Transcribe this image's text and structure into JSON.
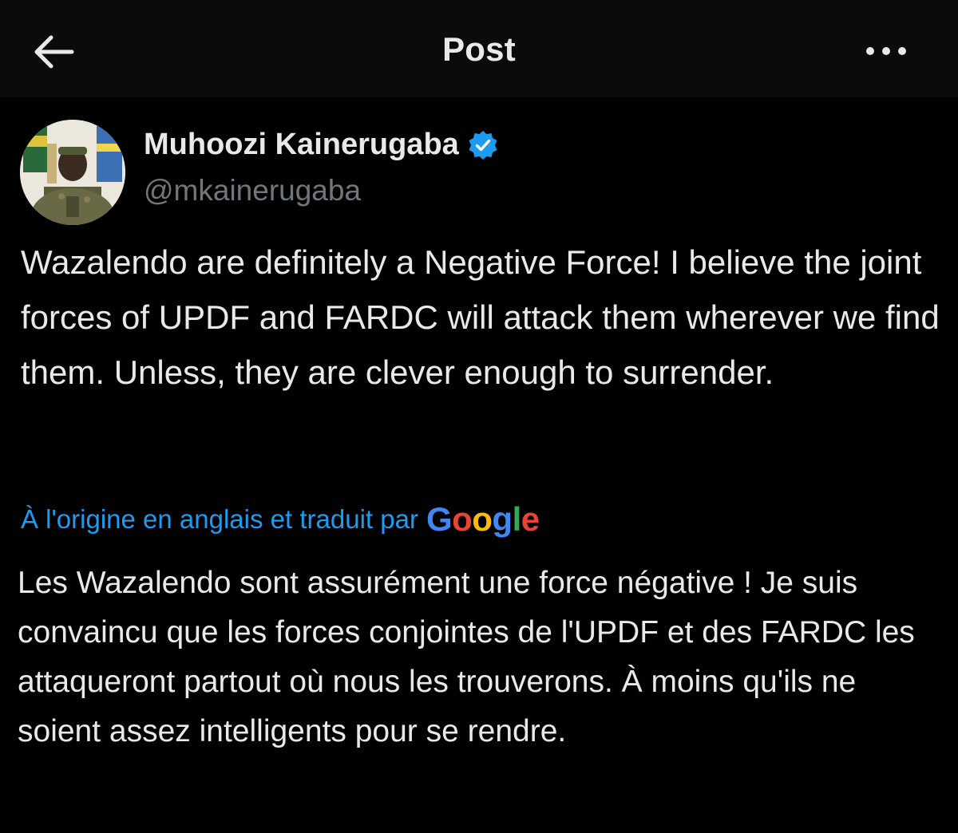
{
  "header": {
    "title": "Post",
    "back_icon": "arrow-left-icon",
    "more_icon": "more-horizontal-icon"
  },
  "post": {
    "author": {
      "name": "Muhoozi Kainerugaba",
      "handle": "@mkainerugaba",
      "verified": true,
      "verified_color": "#1d9bf0"
    },
    "text": "Wazalendo are definitely a Negative Force! I believe the joint forces of UPDF and FARDC will attack them wherever we find them. Unless, they are clever enough to surrender.",
    "translation": {
      "note": "À l'origine en anglais et traduit par",
      "provider": "Google",
      "text": "Les Wazalendo sont assurément une force négative ! Je suis convaincu que les forces conjointes de l'UPDF et des FARDC les attaqueront partout où nous les trouverons. À moins qu'ils ne soient assez intelligents pour se rendre."
    }
  },
  "colors": {
    "background": "#000000",
    "text_primary": "#e7e9ea",
    "text_secondary": "#71767b",
    "accent": "#1d9bf0"
  }
}
